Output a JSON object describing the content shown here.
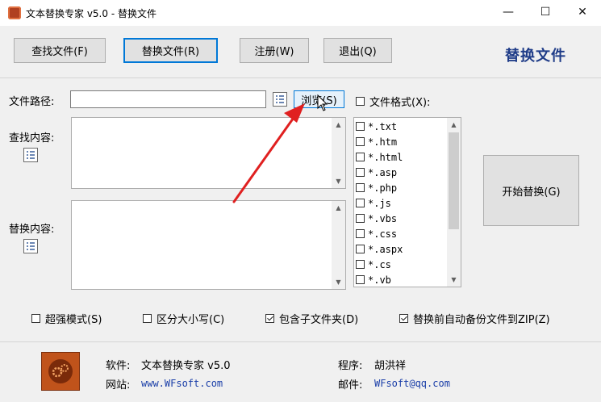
{
  "window": {
    "title": "文本替换专家 v5.0  -  替换文件",
    "minimize_glyph": "—",
    "maximize_glyph": "☐",
    "close_glyph": "✕"
  },
  "toolbar": {
    "find_label": "查找文件(F)",
    "replace_label": "替换文件(R)",
    "register_label": "注册(W)",
    "exit_label": "退出(Q)",
    "brand_title": "替换文件"
  },
  "form": {
    "file_path_label": "文件路径:",
    "file_path_value": "",
    "browse_label": "浏览(S)",
    "file_format_label": "文件格式(X):",
    "find_content_label": "查找内容:",
    "find_content_value": "",
    "replace_content_label": "替换内容:",
    "replace_content_value": "",
    "formats": [
      "*.txt",
      "*.htm",
      "*.html",
      "*.asp",
      "*.php",
      "*.js",
      "*.vbs",
      "*.css",
      "*.aspx",
      "*.cs",
      "*.vb"
    ],
    "start_label": "开始替换(G)"
  },
  "options": {
    "super_mode": "超强模式(S)",
    "case_sensitive": "区分大小写(C)",
    "include_subfolders": "包含子文件夹(D)",
    "backup_zip": "替换前自动备份文件到ZIP(Z)"
  },
  "footer": {
    "software_label": "软件:",
    "software_value": "文本替换专家 v5.0",
    "author_label": "程序:",
    "author_value": "胡洪祥",
    "website_label": "网站:",
    "website_value": "www.WFsoft.com",
    "email_label": "邮件:",
    "email_value": "WFsoft@qq.com"
  },
  "colors": {
    "brand_title": "#1f3c88",
    "link": "#1a3ea8",
    "arrow": "#e02020",
    "focus_border": "#0078d7"
  }
}
